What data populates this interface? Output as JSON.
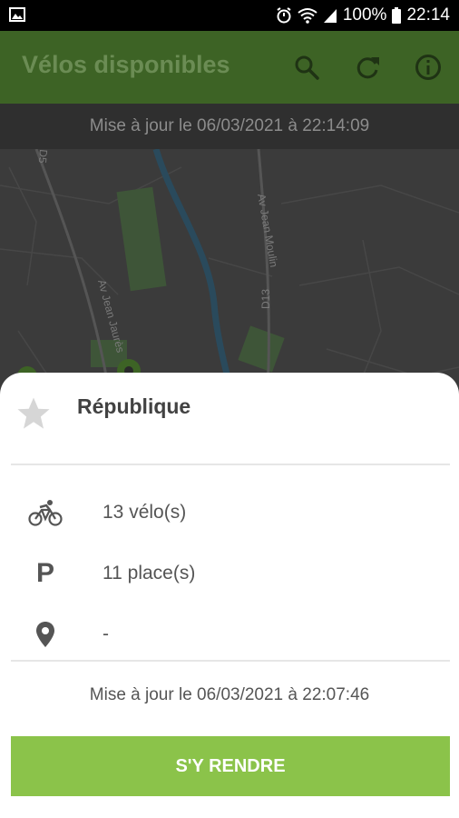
{
  "status_bar": {
    "battery": "100%",
    "time": "22:14"
  },
  "app_bar": {
    "title": "Vélos disponibles"
  },
  "update_banner": {
    "text": "Mise à jour le 06/03/2021 à 22:14:09"
  },
  "map": {
    "street_labels": [
      "Av Jean Moulin",
      "Av Jean Jaurès",
      "D13",
      "D5"
    ]
  },
  "station": {
    "name": "République",
    "bikes": "13 vélo(s)",
    "places": "11 place(s)",
    "address": "-",
    "updated": "Mise à jour le 06/03/2021 à 22:07:46",
    "go_label": "S'Y RENDRE"
  },
  "colors": {
    "app_bar": "#3d6325",
    "accent": "#8bc34a",
    "map_bg": "#3b3b3b"
  }
}
